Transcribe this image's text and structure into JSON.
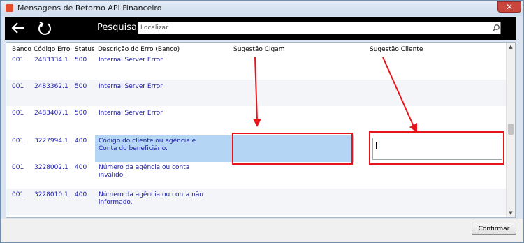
{
  "window": {
    "title": "Mensagens de Retorno API Financeiro"
  },
  "toolbar": {
    "search_label": "Pesquisar",
    "search_placeholder": "Localizar"
  },
  "grid": {
    "columns": [
      "Banco",
      "Código Erro",
      "Status",
      "Descrição do Erro (Banco)",
      "Sugestão Cigam",
      "Sugestão Cliente"
    ],
    "rows": [
      {
        "banco": "001",
        "codigo": "2483334.1",
        "status": "500",
        "descricao": "Internal Server Error"
      },
      {
        "banco": "001",
        "codigo": "2483362.1",
        "status": "500",
        "descricao": "Internal Server Error"
      },
      {
        "banco": "001",
        "codigo": "2483407.1",
        "status": "500",
        "descricao": "Internal Server Error"
      },
      {
        "banco": "001",
        "codigo": "3227994.1",
        "status": "400",
        "descricao": "Código do cliente ou agência e Conta do beneficiário."
      },
      {
        "banco": "001",
        "codigo": "3228002.1",
        "status": "400",
        "descricao": "Número da agência ou conta inválido."
      },
      {
        "banco": "001",
        "codigo": "3228010.1",
        "status": "400",
        "descricao": "Número da agência ou conta não informado."
      }
    ]
  },
  "footer": {
    "confirm_label": "Confirmar"
  },
  "colors": {
    "annotation": "#e8141c",
    "selection": "#b5d5f5",
    "toolbar": "#000000",
    "cell_text": "#1a1aa8"
  }
}
